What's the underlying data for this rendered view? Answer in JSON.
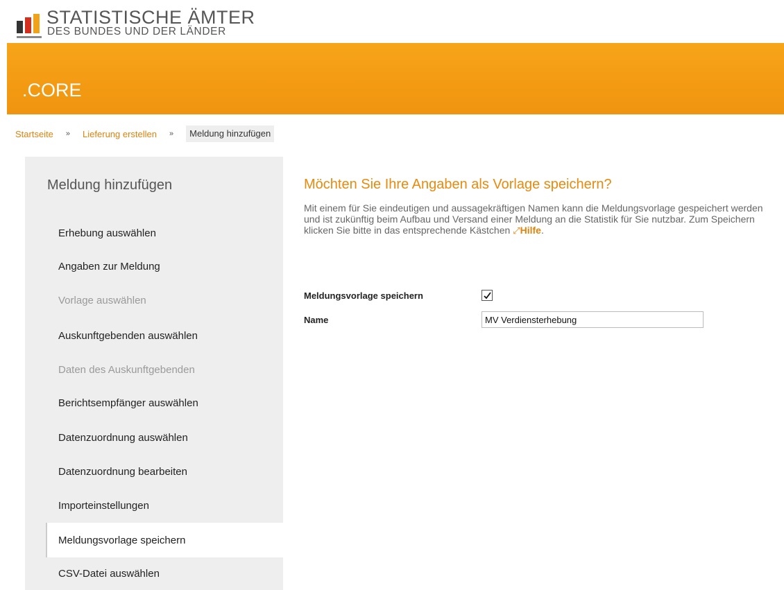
{
  "header": {
    "org_line1": "STATISTISCHE ÄMTER",
    "org_line2": "DES BUNDES UND DER LÄNDER",
    "product": ".CORE"
  },
  "breadcrumb": {
    "items": [
      "Startseite",
      "Lieferung erstellen",
      "Meldung hinzufügen"
    ],
    "separator": "»"
  },
  "sidebar": {
    "title": "Meldung hinzufügen",
    "items": [
      {
        "label": "Erhebung auswählen",
        "state": "enabled"
      },
      {
        "label": "Angaben zur Meldung",
        "state": "enabled"
      },
      {
        "label": "Vorlage auswählen",
        "state": "disabled"
      },
      {
        "label": "Auskunftgebenden auswählen",
        "state": "enabled"
      },
      {
        "label": "Daten des Auskunftgebenden",
        "state": "disabled"
      },
      {
        "label": "Berichtsempfänger auswählen",
        "state": "enabled"
      },
      {
        "label": "Datenzuordnung auswählen",
        "state": "enabled"
      },
      {
        "label": "Datenzuordnung bearbeiten",
        "state": "enabled"
      },
      {
        "label": "Importeinstellungen",
        "state": "enabled"
      },
      {
        "label": "Meldungsvorlage speichern",
        "state": "active"
      },
      {
        "label": "CSV-Datei auswählen",
        "state": "enabled"
      }
    ]
  },
  "main": {
    "heading": "Möchten Sie Ihre Angaben als Vorlage speichern?",
    "description": "Mit einem für Sie eindeutigen und aussagekräftigen Namen kann die Meldungsvorlage gespeichert werden und ist zukünftig beim Aufbau und Versand einer Meldung an die Statistik für Sie nutzbar. Zum Speichern klicken Sie bitte in das entsprechende Kästchen",
    "help_icon": "external-link-icon",
    "help_link": "Hilfe",
    "help_suffix": ".",
    "form": {
      "save_label": "Meldungsvorlage speichern",
      "save_checked": true,
      "name_label": "Name",
      "name_value": "MV Verdiensterhebung"
    }
  },
  "colors": {
    "accent": "#f39a12",
    "link": "#e0820c",
    "heading": "#e88a0d",
    "sidebar_bg": "#eeeeee",
    "logo_bars": [
      "#333333",
      "#d32f1f",
      "#f0a31a"
    ]
  }
}
